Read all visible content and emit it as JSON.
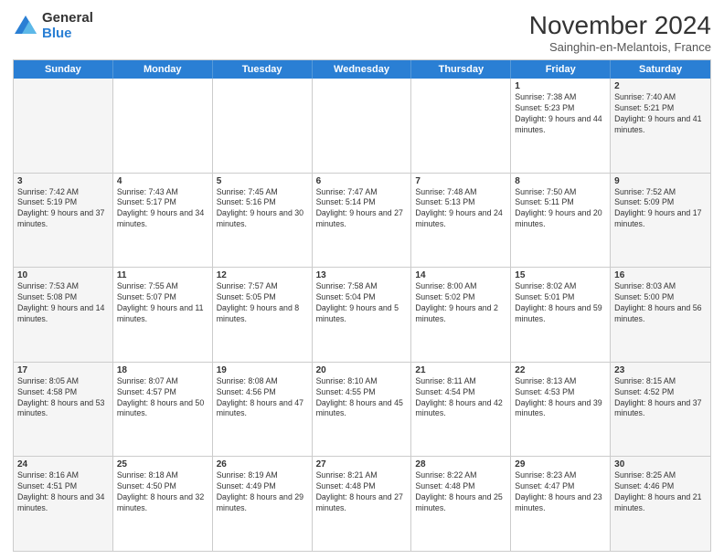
{
  "logo": {
    "general": "General",
    "blue": "Blue"
  },
  "title": "November 2024",
  "subtitle": "Sainghin-en-Melantois, France",
  "header_days": [
    "Sunday",
    "Monday",
    "Tuesday",
    "Wednesday",
    "Thursday",
    "Friday",
    "Saturday"
  ],
  "weeks": [
    [
      {
        "day": "",
        "info": ""
      },
      {
        "day": "",
        "info": ""
      },
      {
        "day": "",
        "info": ""
      },
      {
        "day": "",
        "info": ""
      },
      {
        "day": "",
        "info": ""
      },
      {
        "day": "1",
        "info": "Sunrise: 7:38 AM\nSunset: 5:23 PM\nDaylight: 9 hours and 44 minutes."
      },
      {
        "day": "2",
        "info": "Sunrise: 7:40 AM\nSunset: 5:21 PM\nDaylight: 9 hours and 41 minutes."
      }
    ],
    [
      {
        "day": "3",
        "info": "Sunrise: 7:42 AM\nSunset: 5:19 PM\nDaylight: 9 hours and 37 minutes."
      },
      {
        "day": "4",
        "info": "Sunrise: 7:43 AM\nSunset: 5:17 PM\nDaylight: 9 hours and 34 minutes."
      },
      {
        "day": "5",
        "info": "Sunrise: 7:45 AM\nSunset: 5:16 PM\nDaylight: 9 hours and 30 minutes."
      },
      {
        "day": "6",
        "info": "Sunrise: 7:47 AM\nSunset: 5:14 PM\nDaylight: 9 hours and 27 minutes."
      },
      {
        "day": "7",
        "info": "Sunrise: 7:48 AM\nSunset: 5:13 PM\nDaylight: 9 hours and 24 minutes."
      },
      {
        "day": "8",
        "info": "Sunrise: 7:50 AM\nSunset: 5:11 PM\nDaylight: 9 hours and 20 minutes."
      },
      {
        "day": "9",
        "info": "Sunrise: 7:52 AM\nSunset: 5:09 PM\nDaylight: 9 hours and 17 minutes."
      }
    ],
    [
      {
        "day": "10",
        "info": "Sunrise: 7:53 AM\nSunset: 5:08 PM\nDaylight: 9 hours and 14 minutes."
      },
      {
        "day": "11",
        "info": "Sunrise: 7:55 AM\nSunset: 5:07 PM\nDaylight: 9 hours and 11 minutes."
      },
      {
        "day": "12",
        "info": "Sunrise: 7:57 AM\nSunset: 5:05 PM\nDaylight: 9 hours and 8 minutes."
      },
      {
        "day": "13",
        "info": "Sunrise: 7:58 AM\nSunset: 5:04 PM\nDaylight: 9 hours and 5 minutes."
      },
      {
        "day": "14",
        "info": "Sunrise: 8:00 AM\nSunset: 5:02 PM\nDaylight: 9 hours and 2 minutes."
      },
      {
        "day": "15",
        "info": "Sunrise: 8:02 AM\nSunset: 5:01 PM\nDaylight: 8 hours and 59 minutes."
      },
      {
        "day": "16",
        "info": "Sunrise: 8:03 AM\nSunset: 5:00 PM\nDaylight: 8 hours and 56 minutes."
      }
    ],
    [
      {
        "day": "17",
        "info": "Sunrise: 8:05 AM\nSunset: 4:58 PM\nDaylight: 8 hours and 53 minutes."
      },
      {
        "day": "18",
        "info": "Sunrise: 8:07 AM\nSunset: 4:57 PM\nDaylight: 8 hours and 50 minutes."
      },
      {
        "day": "19",
        "info": "Sunrise: 8:08 AM\nSunset: 4:56 PM\nDaylight: 8 hours and 47 minutes."
      },
      {
        "day": "20",
        "info": "Sunrise: 8:10 AM\nSunset: 4:55 PM\nDaylight: 8 hours and 45 minutes."
      },
      {
        "day": "21",
        "info": "Sunrise: 8:11 AM\nSunset: 4:54 PM\nDaylight: 8 hours and 42 minutes."
      },
      {
        "day": "22",
        "info": "Sunrise: 8:13 AM\nSunset: 4:53 PM\nDaylight: 8 hours and 39 minutes."
      },
      {
        "day": "23",
        "info": "Sunrise: 8:15 AM\nSunset: 4:52 PM\nDaylight: 8 hours and 37 minutes."
      }
    ],
    [
      {
        "day": "24",
        "info": "Sunrise: 8:16 AM\nSunset: 4:51 PM\nDaylight: 8 hours and 34 minutes."
      },
      {
        "day": "25",
        "info": "Sunrise: 8:18 AM\nSunset: 4:50 PM\nDaylight: 8 hours and 32 minutes."
      },
      {
        "day": "26",
        "info": "Sunrise: 8:19 AM\nSunset: 4:49 PM\nDaylight: 8 hours and 29 minutes."
      },
      {
        "day": "27",
        "info": "Sunrise: 8:21 AM\nSunset: 4:48 PM\nDaylight: 8 hours and 27 minutes."
      },
      {
        "day": "28",
        "info": "Sunrise: 8:22 AM\nSunset: 4:48 PM\nDaylight: 8 hours and 25 minutes."
      },
      {
        "day": "29",
        "info": "Sunrise: 8:23 AM\nSunset: 4:47 PM\nDaylight: 8 hours and 23 minutes."
      },
      {
        "day": "30",
        "info": "Sunrise: 8:25 AM\nSunset: 4:46 PM\nDaylight: 8 hours and 21 minutes."
      }
    ]
  ]
}
